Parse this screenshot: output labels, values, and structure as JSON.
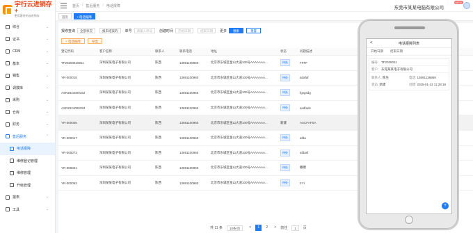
{
  "logo": {
    "title": "宇行云进销存+",
    "subtitle": "更用客进的云进销存"
  },
  "sidebar": {
    "items": [
      {
        "label": "综合"
      },
      {
        "label": "证书"
      },
      {
        "label": "CRM"
      },
      {
        "label": "基本"
      },
      {
        "label": "销售"
      },
      {
        "label": "调拨库"
      },
      {
        "label": "采购"
      },
      {
        "label": "仓库"
      },
      {
        "label": "财务"
      },
      {
        "label": "售后服务"
      }
    ],
    "subitems": [
      {
        "label": "电话报障"
      },
      {
        "label": "维修登记管理"
      },
      {
        "label": "维修管理"
      },
      {
        "label": "升级管理"
      },
      {
        "label": "报表"
      },
      {
        "label": "工具"
      }
    ]
  },
  "topbar": {
    "breadcrumb": [
      "首页",
      "售后服务",
      "电话报障"
    ],
    "company": "东莞市某某电脑有限公司",
    "badge": "NEW"
  },
  "tabs": [
    {
      "label": "首页"
    },
    {
      "label": "• 电话报障"
    }
  ],
  "filters": {
    "query_label": "报修查询",
    "query_value": "全部状况",
    "query2_value": "报未结案的",
    "no_label": "单号",
    "no_placeholder": "请输入单号",
    "date_label": "创建时间",
    "date_start": "开始日期",
    "date_end": "结束日期",
    "more": "更多",
    "search": "搜索",
    "reset": "重置"
  },
  "actions": {
    "add": "+ 电话报障",
    "export": "导出"
  },
  "table": {
    "headers": [
      "登记代码",
      "客户名称",
      "联系人",
      "联系电话",
      "地址",
      "状态",
      "问题描述"
    ],
    "rows": [
      [
        "TF20250610011",
        "深圳某某电子有限公司",
        "陈西",
        "13691100960",
        "北京市东城区金山大道100号AAAAAAA...",
        "待处",
        "FFFF"
      ],
      [
        "YR-000015",
        "深圳某某电子有限公司",
        "陈西",
        "13691100960",
        "北京市东城区金山大道100号AAAAAAA...",
        "待处",
        "adafaf"
      ],
      [
        "ASR2024000152",
        "深圳某某电子有限公司",
        "陈西",
        "13691100960",
        "北京市东城区金山大道100号AAAAAAA...",
        "待处",
        "fgsgsdg"
      ],
      [
        "ASR2024000153",
        "深圳某某电子有限公司",
        "陈西",
        "13691100960",
        "北京市东城区金山大道100号AAAAAAA...",
        "待处",
        "asdfads"
      ],
      [
        "YR-000005",
        "深圳某某电子有限公司",
        "陈西",
        "13691100960",
        "北京市东城区金山大道100号AAAAAAA...",
        "新建",
        "ASCFAFSA"
      ],
      [
        "YR-000017",
        "深圳某某电子有限公司",
        "陈西",
        "13691100960",
        "北京市东城区金山大道100号AAAAAAA...",
        "待处",
        "afda"
      ],
      [
        "YR-000073",
        "深圳某某电子有限公司",
        "陈西",
        "13691100960",
        "北京市东城区金山大道100号AAAAAAA...",
        "待处",
        "afdasf"
      ],
      [
        "YR-000021",
        "深圳某某电子有限公司",
        "陈西",
        "13691100960",
        "北京市东城区金山大道100号AAAAAAA...",
        "待处",
        "撒擦"
      ],
      [
        "YR-000063",
        "深圳某某电子有限公司",
        "陈西",
        "13691100960",
        "北京市东城区金山大道100号AAAAAAA...",
        "待处",
        "FYI"
      ]
    ]
  },
  "pager": {
    "total": "共 11 条",
    "size": "10条/页",
    "prev": "<",
    "p1": "1",
    "p2": "2",
    "next": ">",
    "goto": "前往",
    "page": "1",
    "suffix": "页"
  },
  "phone": {
    "title": "电话报障列表",
    "back": "<",
    "date_start": "开始日期",
    "date_end": "结束日期",
    "card": {
      "no_label": "编号:",
      "no_value": "TF2025011",
      "customer_label": "客户:",
      "customer_value": "东莞某某电子有限公司",
      "contact_label": "联系人:",
      "contact_value": "陈生",
      "phone_label": "电话:",
      "phone_value": "13691136959",
      "status_label": "状态:",
      "status_value": "新建",
      "time_label": "创建:",
      "time_value": "2025-01-13 11:28:18"
    },
    "fab": "+"
  }
}
